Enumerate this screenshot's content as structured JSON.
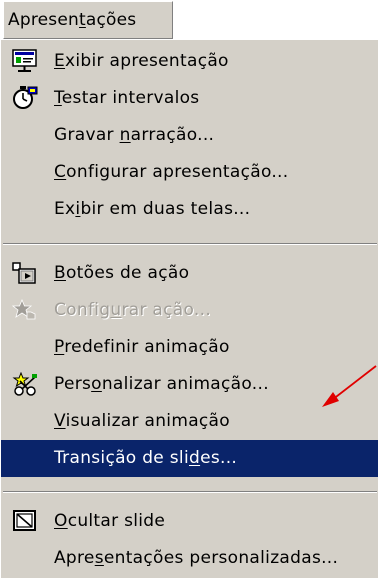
{
  "menu": {
    "title_parts": [
      "Apresen",
      "t",
      "ações"
    ],
    "items": [
      {
        "label_parts": [
          "",
          "E",
          "xibir apresentação"
        ],
        "icon": "slideshow-icon"
      },
      {
        "label_parts": [
          "",
          "T",
          "estar intervalos"
        ],
        "icon": "stopwatch-icon"
      },
      {
        "label_parts": [
          "Gravar ",
          "n",
          "arração..."
        ]
      },
      {
        "label_parts": [
          "",
          "C",
          "onfigurar apresentação..."
        ]
      },
      {
        "label_parts": [
          "Ex",
          "i",
          "bir em duas telas..."
        ]
      },
      {
        "label_parts": [
          "",
          "B",
          "otões de ação"
        ],
        "icon": "action-buttons-icon"
      },
      {
        "label_parts": [
          "Config",
          "u",
          "rar ação..."
        ],
        "icon": "action-settings-icon",
        "disabled": true
      },
      {
        "label_parts": [
          "",
          "P",
          "redefinir animação"
        ]
      },
      {
        "label_parts": [
          "Pers",
          "o",
          "nalizar animação..."
        ],
        "icon": "custom-animation-icon"
      },
      {
        "label_parts": [
          "",
          "V",
          "isualizar animação"
        ]
      },
      {
        "label_parts": [
          "Transição de sli",
          "d",
          "es..."
        ],
        "highlighted": true
      },
      {
        "label_parts": [
          "",
          "O",
          "cultar slide"
        ],
        "icon": "hide-slide-icon"
      },
      {
        "label_parts": [
          "Apre",
          "s",
          "entações personalizadas..."
        ]
      }
    ]
  },
  "colors": {
    "menu_background": "#d4d0c8",
    "highlight": "#0a246a",
    "arrow": "#e00000"
  }
}
